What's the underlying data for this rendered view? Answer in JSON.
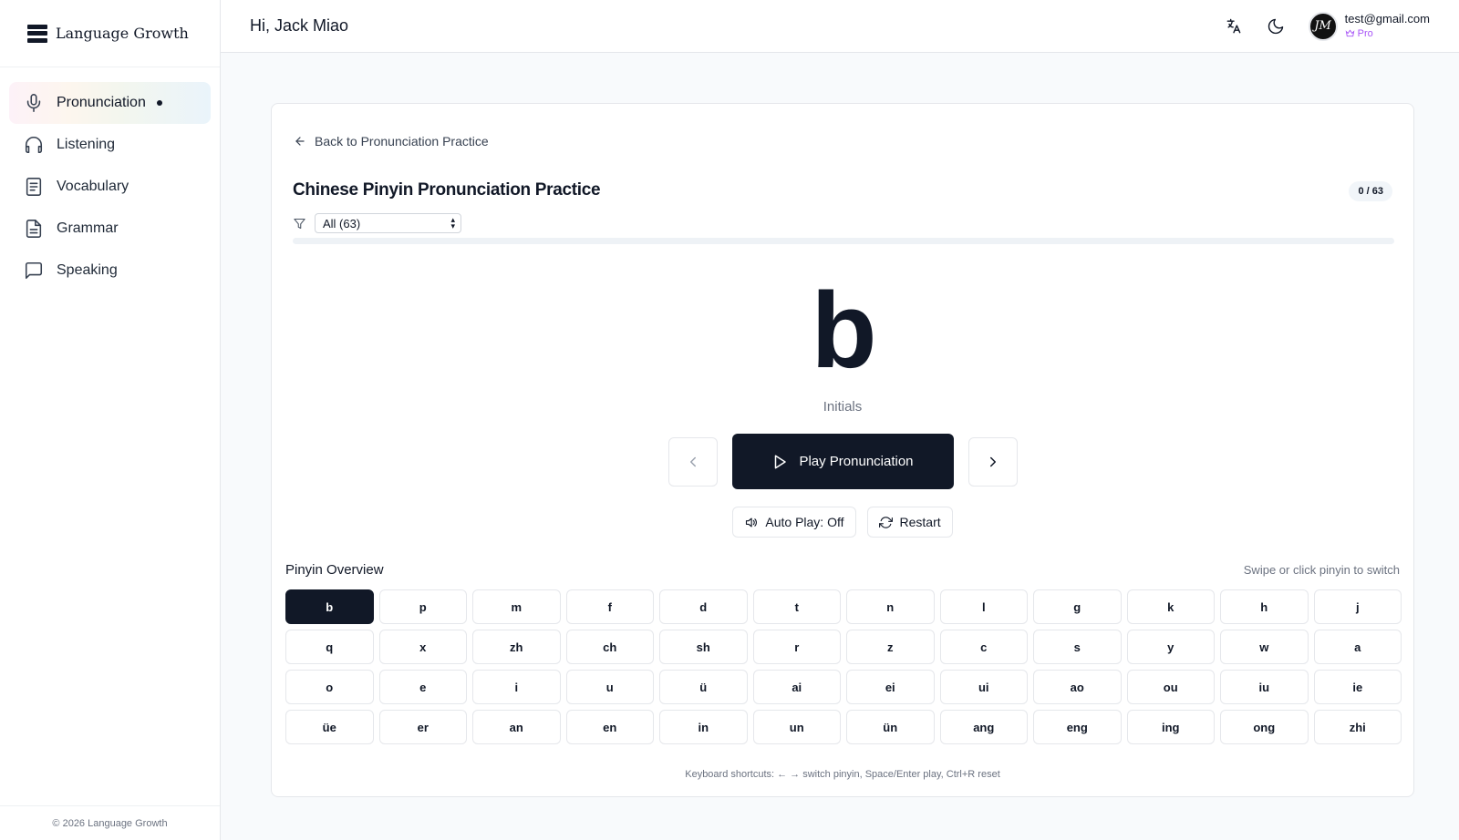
{
  "brand": {
    "name": "Language Growth"
  },
  "sidebar": {
    "items": [
      {
        "label": "Pronunciation",
        "icon": "mic-icon",
        "active": true
      },
      {
        "label": "Listening",
        "icon": "headphones-icon"
      },
      {
        "label": "Vocabulary",
        "icon": "document-icon"
      },
      {
        "label": "Grammar",
        "icon": "file-text-icon"
      },
      {
        "label": "Speaking",
        "icon": "message-icon"
      }
    ],
    "footer": "© 2026 Language Growth"
  },
  "header": {
    "greeting": "Hi, Jack Miao",
    "user": {
      "email": "test@gmail.com",
      "plan": "Pro",
      "avatar_initials": "JM"
    }
  },
  "practice": {
    "back_label": "Back to Pronunciation Practice",
    "title": "Chinese Pinyin Pronunciation Practice",
    "counter": "0 / 63",
    "filter_value": "All (63)",
    "progress": 0,
    "current_pinyin": "b",
    "current_category": "Initials",
    "play_label": "Play Pronunciation",
    "autoplay_label": "Auto Play: Off",
    "restart_label": "Restart",
    "overview_title": "Pinyin Overview",
    "overview_hint": "Swipe or click pinyin to switch",
    "shortcuts": "Keyboard shortcuts: ← → switch pinyin, Space/Enter play, Ctrl+R reset",
    "pinyin": [
      "b",
      "p",
      "m",
      "f",
      "d",
      "t",
      "n",
      "l",
      "g",
      "k",
      "h",
      "j",
      "q",
      "x",
      "zh",
      "ch",
      "sh",
      "r",
      "z",
      "c",
      "s",
      "y",
      "w",
      "a",
      "o",
      "e",
      "i",
      "u",
      "ü",
      "ai",
      "ei",
      "ui",
      "ao",
      "ou",
      "iu",
      "ie",
      "üe",
      "er",
      "an",
      "en",
      "in",
      "un",
      "ün",
      "ang",
      "eng",
      "ing",
      "ong",
      "zhi",
      "",
      "",
      "",
      "",
      "",
      "",
      "",
      "",
      "",
      "",
      "",
      ""
    ]
  },
  "colors": {
    "primary": "#111827",
    "pro": "#a855f7"
  }
}
